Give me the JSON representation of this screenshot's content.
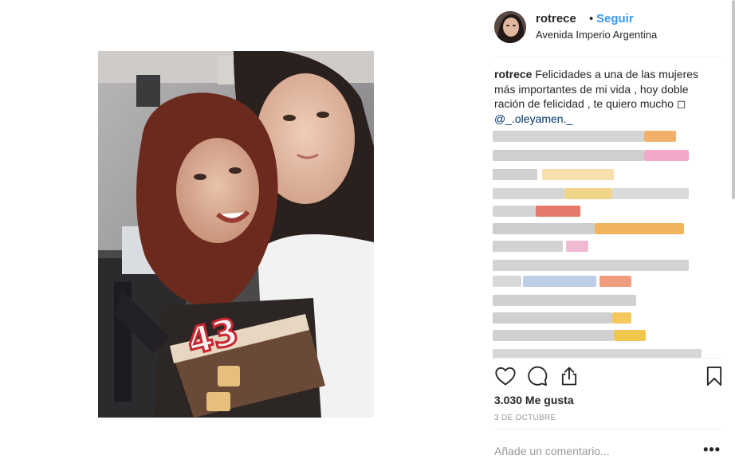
{
  "post": {
    "username": "rotrece",
    "separator": "•",
    "follow_label": "Seguir",
    "location": "Avenida Imperio Argentina",
    "caption": {
      "username": "rotrece",
      "text": "Felicidades a una de las mujeres más importantes de mi vida , hoy doble ración de felicidad , te quiero mucho ◻",
      "mention": "@_.oleyamen._"
    },
    "photo": {
      "cake_number": "43"
    },
    "likes": "3.030 Me gusta",
    "date": "3 DE OCTUBRE",
    "comment_placeholder": "Añade un comentario...",
    "more_label": "•••"
  },
  "icons": {
    "like": "heart-icon",
    "comment": "comment-bubble-icon",
    "share": "share-icon",
    "save": "bookmark-icon"
  },
  "colors": {
    "link_blue": "#3897f0",
    "mention_blue": "#003569",
    "text": "#262626",
    "muted": "#999999",
    "divider": "#efefef"
  }
}
